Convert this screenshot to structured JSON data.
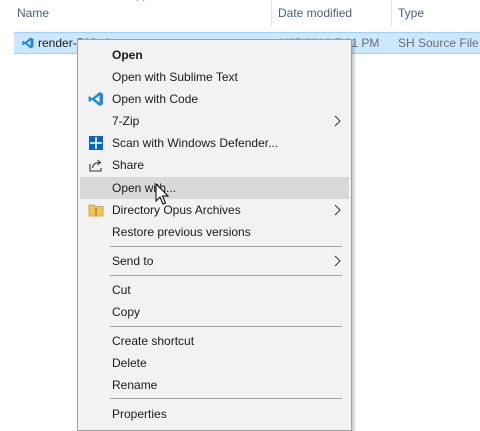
{
  "columns": {
    "name": "Name",
    "date_modified": "Date modified",
    "type": "Type"
  },
  "file": {
    "name": "render-512.sh",
    "date_modified": "1/25/2019 7:31 PM",
    "type": "SH Source File"
  },
  "menu": {
    "open": "Open",
    "open_sublime": "Open with Sublime Text",
    "open_code": "Open with Code",
    "zip": "7-Zip",
    "defender": "Scan with Windows Defender...",
    "share": "Share",
    "open_with": "Open with...",
    "dopus": "Directory Opus Archives",
    "restore": "Restore previous versions",
    "send_to": "Send to",
    "cut": "Cut",
    "copy": "Copy",
    "create_shortcut": "Create shortcut",
    "delete": "Delete",
    "rename": "Rename",
    "properties": "Properties"
  },
  "colors": {
    "selection": "#cce8ff",
    "menu_bg": "#f2f2f2",
    "menu_highlight": "#d9d9d9",
    "vscode_blue": "#1e88e5",
    "defender_blue": "#0a64c8"
  }
}
